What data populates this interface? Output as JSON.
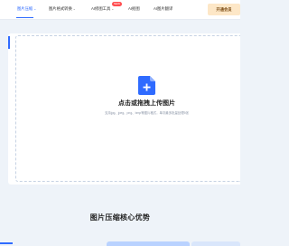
{
  "nav": {
    "items": [
      {
        "label": "图片压缩",
        "has_dropdown": true,
        "active": true
      },
      {
        "label": "图片格式转换",
        "has_dropdown": true,
        "active": false
      },
      {
        "label": "AI修图工具",
        "has_dropdown": true,
        "active": false
      },
      {
        "label": "AI抠图",
        "has_dropdown": false,
        "active": false
      },
      {
        "label": "AI图片翻译",
        "has_dropdown": false,
        "active": false
      }
    ],
    "badge": "NEW",
    "vip_label": "开通会员"
  },
  "upload": {
    "icon": "add-file-icon",
    "title": "点击或拖拽上传图片",
    "hint": "支持jpg、jpeg、png、bmp等图片格式，单次最多批量处理5张"
  },
  "section": {
    "title": "图片压缩核心优势"
  },
  "colors": {
    "accent": "#2f6bff",
    "vip_bg": "#fde7c7",
    "page_bg": "#eef3f9"
  }
}
